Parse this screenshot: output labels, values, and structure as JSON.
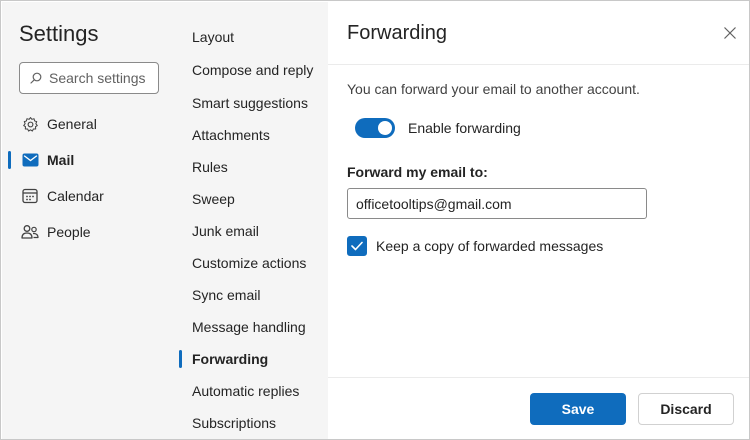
{
  "sidebar": {
    "title": "Settings",
    "search_placeholder": "Search settings",
    "items": [
      {
        "label": "General",
        "icon": "gear-icon",
        "active": false
      },
      {
        "label": "Mail",
        "icon": "mail-icon",
        "active": true
      },
      {
        "label": "Calendar",
        "icon": "calendar-icon",
        "active": false
      },
      {
        "label": "People",
        "icon": "people-icon",
        "active": false
      }
    ]
  },
  "submenu": {
    "items": [
      "Layout",
      "Compose and reply",
      "Smart suggestions",
      "Attachments",
      "Rules",
      "Sweep",
      "Junk email",
      "Customize actions",
      "Sync email",
      "Message handling",
      "Forwarding",
      "Automatic replies",
      "Subscriptions"
    ],
    "active": "Forwarding"
  },
  "panel": {
    "title": "Forwarding",
    "description": "You can forward your email to another account.",
    "toggle_label": "Enable forwarding",
    "toggle_on": true,
    "forward_label": "Forward my email to:",
    "forward_value": "officetooltips@gmail.com",
    "keep_copy_label": "Keep a copy of forwarded messages",
    "keep_copy_checked": true,
    "save_label": "Save",
    "discard_label": "Discard"
  },
  "colors": {
    "accent": "#0f6cbd",
    "nav_bg": "#f5f5f5",
    "text": "#242424"
  }
}
